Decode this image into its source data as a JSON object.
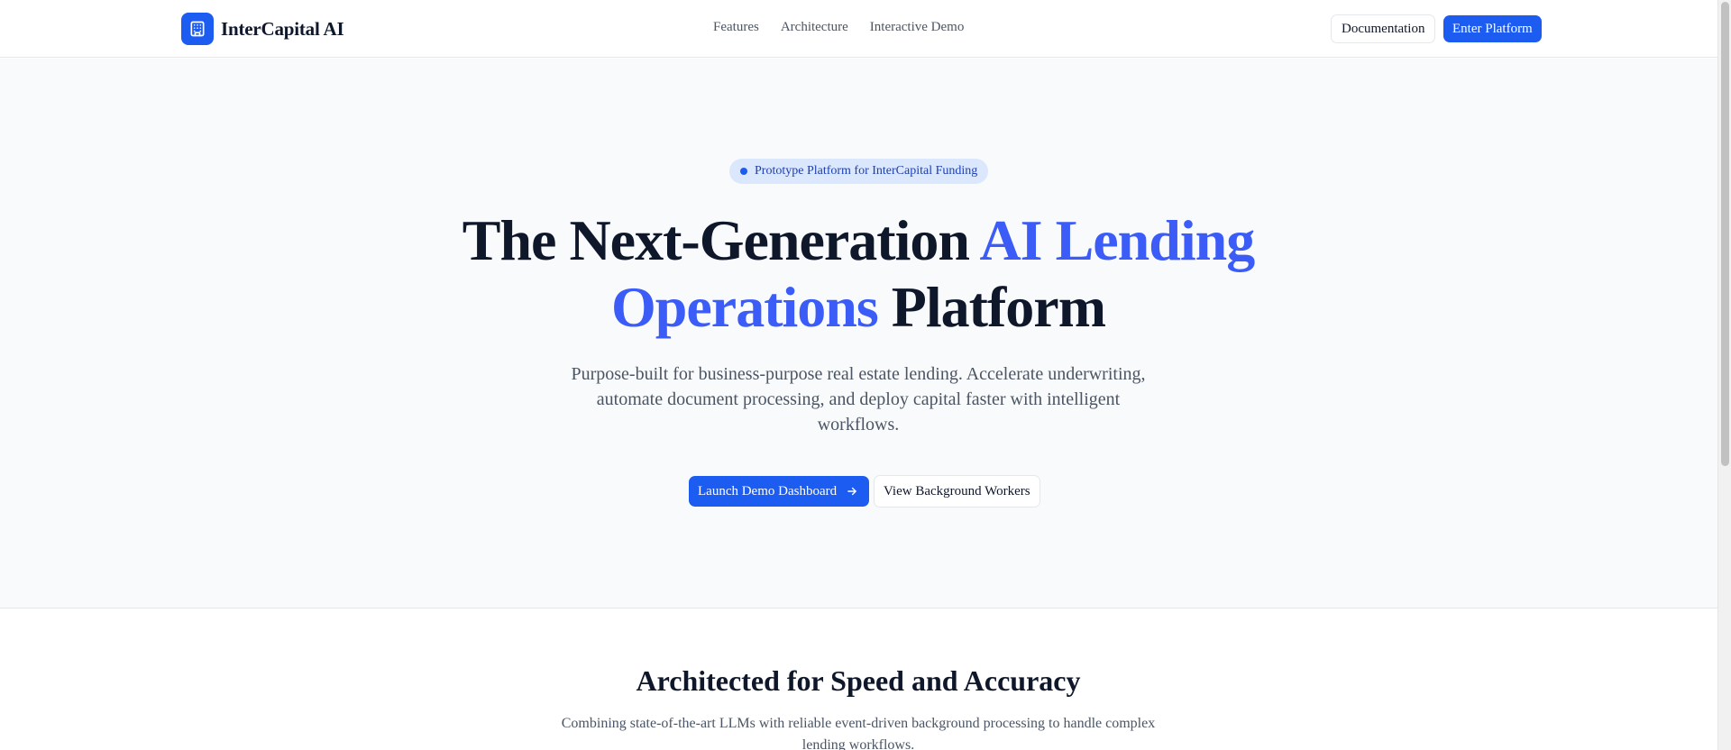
{
  "nav": {
    "brand_name": "InterCapital AI",
    "brand_icon": "building-icon",
    "links": [
      {
        "label": "Features"
      },
      {
        "label": "Architecture"
      },
      {
        "label": "Interactive Demo"
      }
    ],
    "documentation_label": "Documentation",
    "enter_label": "Enter Platform"
  },
  "hero": {
    "badge": "Prototype Platform for InterCapital Funding",
    "headline_part1": "The Next-Generation ",
    "headline_accent": "AI Lending Operations",
    "headline_part2": " Platform",
    "subhead": "Purpose-built for business-purpose real estate lending. Accelerate underwriting, automate document processing, and deploy capital faster with intelligent workflows.",
    "primary_cta": "Launch Demo Dashboard",
    "secondary_cta": "View Background Workers"
  },
  "section": {
    "title": "Architected for Speed and Accuracy",
    "subtitle": "Combining state-of-the-art LLMs with reliable event-driven background processing to handle complex lending workflows."
  },
  "colors": {
    "primary": "#1d5cf0",
    "accent_text": "#3b5cf6",
    "heading": "#0f172a",
    "muted": "#4b5563"
  }
}
